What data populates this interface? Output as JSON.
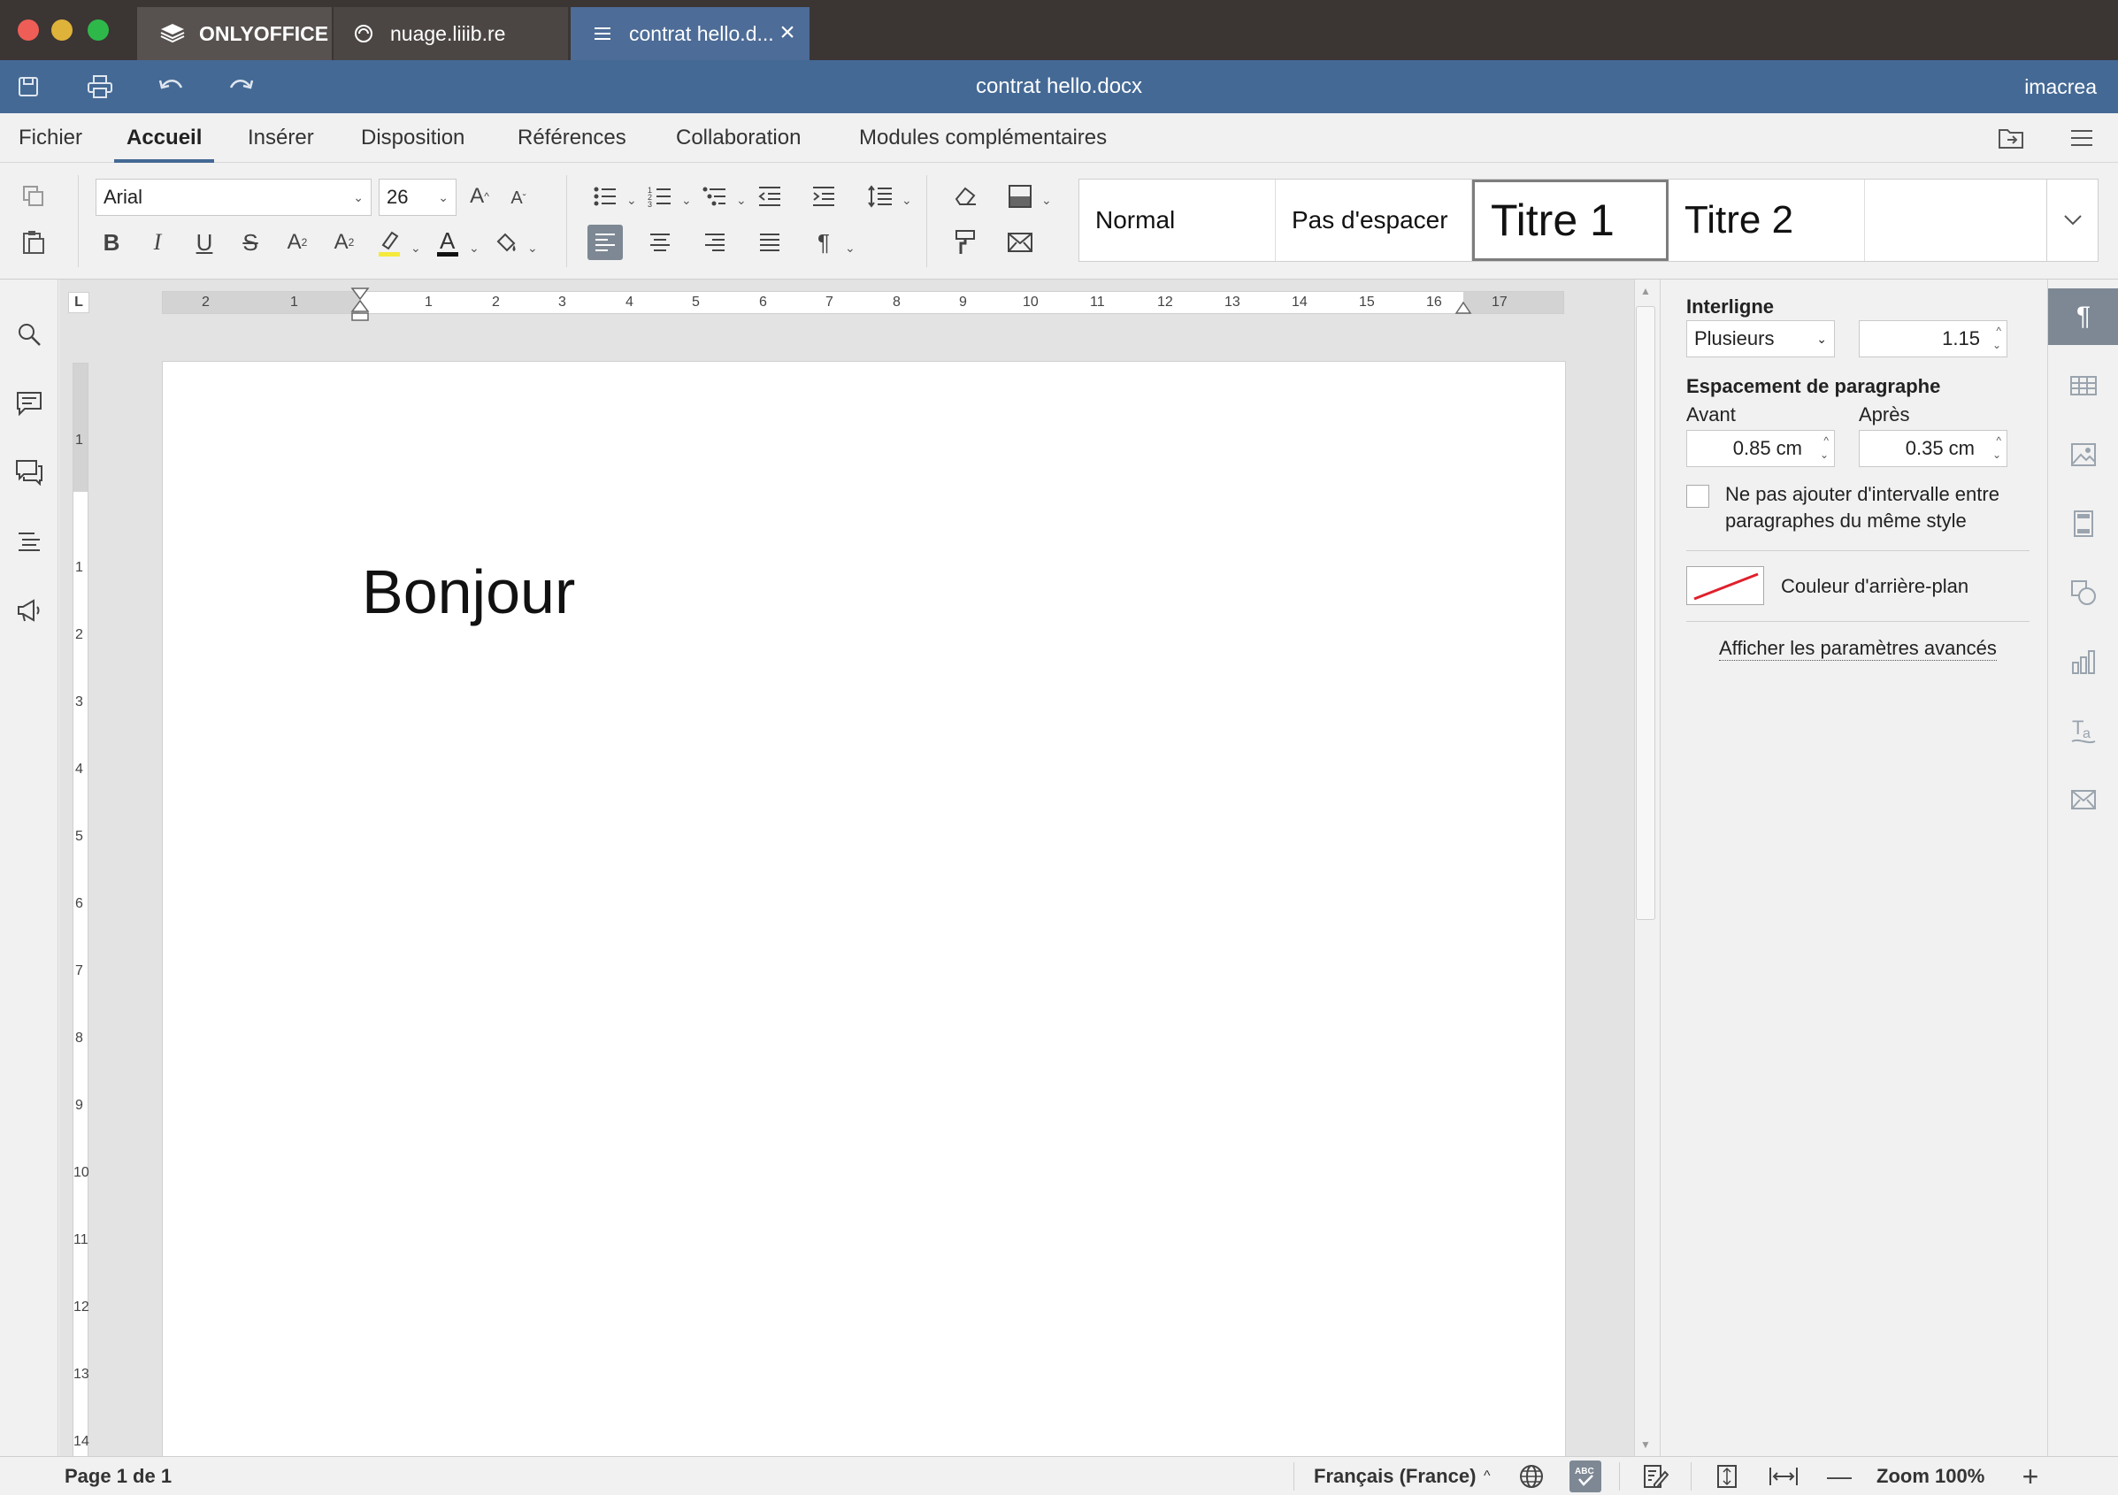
{
  "window": {
    "tabs": [
      {
        "label": "ONLYOFFICE"
      },
      {
        "label": "nuage.liiib.re"
      },
      {
        "label": "contrat hello.d..."
      }
    ]
  },
  "header": {
    "doc_title": "contrat hello.docx",
    "user": "imacrea"
  },
  "menu": {
    "tabs": [
      "Fichier",
      "Accueil",
      "Insérer",
      "Disposition",
      "Références",
      "Collaboration",
      "Modules complémentaires"
    ],
    "active": "Accueil"
  },
  "toolbar": {
    "font_name": "Arial",
    "font_size": "26",
    "styles": [
      "Normal",
      "Pas d'espacer",
      "Titre 1",
      "Titre 2"
    ],
    "selected_style": "Titre 1"
  },
  "ruler": {
    "h_labels": [
      "2",
      "1",
      "1",
      "2",
      "3",
      "4",
      "5",
      "6",
      "7",
      "8",
      "9",
      "10",
      "11",
      "12",
      "13",
      "14",
      "15",
      "16",
      "17"
    ],
    "v_labels": [
      "1",
      "1",
      "2",
      "3",
      "4",
      "5",
      "6",
      "7",
      "8",
      "9",
      "10",
      "11",
      "12",
      "13",
      "14"
    ]
  },
  "document": {
    "body_text": "Bonjour"
  },
  "paragraph_settings": {
    "line_spacing_label": "Interligne",
    "line_spacing_type": "Plusieurs",
    "line_spacing_value": "1.15",
    "spacing_label": "Espacement de paragraphe",
    "before_label": "Avant",
    "before_value": "0.85 cm",
    "after_label": "Après",
    "after_value": "0.35 cm",
    "no_interval_label_line1": "Ne pas ajouter d'intervalle entre",
    "no_interval_label_line2": "paragraphes du même style",
    "no_interval_checked": false,
    "bg_color_label": "Couleur d'arrière-plan",
    "advanced_link": "Afficher les paramètres avancés"
  },
  "statusbar": {
    "page_info": "Page 1 de 1",
    "language": "Français (France)",
    "zoom": "Zoom 100%"
  },
  "colors": {
    "header_blue": "#446995",
    "titlebar": "#3b3534",
    "active_tab": "#4d6c97",
    "highlight_yellow": "#f5e93b",
    "font_color": "#111111"
  }
}
